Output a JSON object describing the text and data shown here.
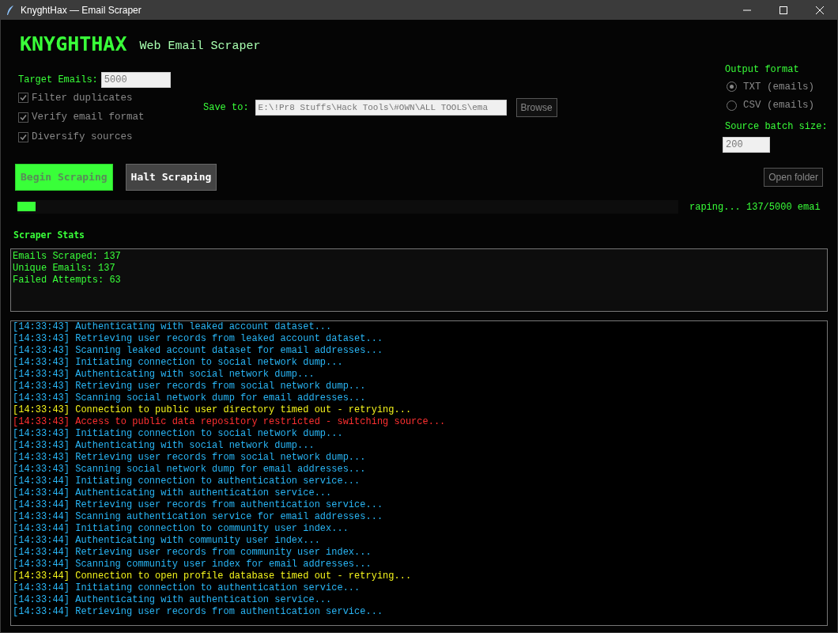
{
  "window": {
    "title": "KnyghtHax — Email Scraper"
  },
  "header": {
    "logo": "KNYGHTHAX",
    "subtitle": "Web Email Scraper"
  },
  "target": {
    "label": "Target Emails:",
    "value": "5000"
  },
  "options": [
    {
      "label": "Filter duplicates",
      "checked": true,
      "disabled": true
    },
    {
      "label": "Verify email format",
      "checked": true,
      "disabled": true
    },
    {
      "label": "Diversify sources",
      "checked": true,
      "disabled": true
    }
  ],
  "save": {
    "label": "Save to:",
    "value": "E:\\!Pr8 Stuffs\\Hack Tools\\#OWN\\ALL TOOLS\\ema",
    "button": {
      "label": "Browse",
      "disabled": true
    }
  },
  "output_format": {
    "label": "Output format",
    "choices": [
      {
        "label": "TXT (emails)",
        "selected": true,
        "disabled": true
      },
      {
        "label": "CSV (emails)",
        "selected": false,
        "disabled": true
      }
    ]
  },
  "batch": {
    "label": "Source batch size:",
    "value": "200"
  },
  "actions": [
    {
      "label": "Begin Scraping",
      "kind": "start",
      "disabled": true
    },
    {
      "label": "Halt Scraping",
      "kind": "stop",
      "disabled": false
    }
  ],
  "open_folder": {
    "label": "Open folder",
    "disabled": true
  },
  "progress": {
    "level": 0.027,
    "status": "raping... 137/5000 emai"
  },
  "stats": {
    "title": "Scraper Stats",
    "lines": [
      "Emails Scraped: 137",
      "Unique Emails: 137",
      "Failed Attempts: 63"
    ]
  },
  "log": [
    {
      "text": "[14:33:43] Authenticating with leaked account dataset...",
      "kind": "info"
    },
    {
      "text": "[14:33:43] Retrieving user records from leaked account dataset...",
      "kind": "info"
    },
    {
      "text": "[14:33:43] Scanning leaked account dataset for email addresses...",
      "kind": "info"
    },
    {
      "text": "[14:33:43] Initiating connection to social network dump...",
      "kind": "info"
    },
    {
      "text": "[14:33:43] Authenticating with social network dump...",
      "kind": "info"
    },
    {
      "text": "[14:33:43] Retrieving user records from social network dump...",
      "kind": "info"
    },
    {
      "text": "[14:33:43] Scanning social network dump for email addresses...",
      "kind": "info"
    },
    {
      "text": "[14:33:43] Connection to public user directory timed out - retrying...",
      "kind": "warning"
    },
    {
      "text": "[14:33:43] Access to public data repository restricted - switching source...",
      "kind": "error"
    },
    {
      "text": "[14:33:43] Initiating connection to social network dump...",
      "kind": "info"
    },
    {
      "text": "[14:33:43] Authenticating with social network dump...",
      "kind": "info"
    },
    {
      "text": "[14:33:43] Retrieving user records from social network dump...",
      "kind": "info"
    },
    {
      "text": "[14:33:43] Scanning social network dump for email addresses...",
      "kind": "info"
    },
    {
      "text": "[14:33:44] Initiating connection to authentication service...",
      "kind": "info"
    },
    {
      "text": "[14:33:44] Authenticating with authentication service...",
      "kind": "info"
    },
    {
      "text": "[14:33:44] Retrieving user records from authentication service...",
      "kind": "info"
    },
    {
      "text": "[14:33:44] Scanning authentication service for email addresses...",
      "kind": "info"
    },
    {
      "text": "[14:33:44] Initiating connection to community user index...",
      "kind": "info"
    },
    {
      "text": "[14:33:44] Authenticating with community user index...",
      "kind": "info"
    },
    {
      "text": "[14:33:44] Retrieving user records from community user index...",
      "kind": "info"
    },
    {
      "text": "[14:33:44] Scanning community user index for email addresses...",
      "kind": "info"
    },
    {
      "text": "[14:33:44] Connection to open profile database timed out - retrying...",
      "kind": "warning"
    },
    {
      "text": "[14:33:44] Initiating connection to authentication service...",
      "kind": "info"
    },
    {
      "text": "[14:33:44] Authenticating with authentication service...",
      "kind": "info"
    },
    {
      "text": "[14:33:44] Retrieving user records from authentication service...",
      "kind": "info"
    }
  ]
}
